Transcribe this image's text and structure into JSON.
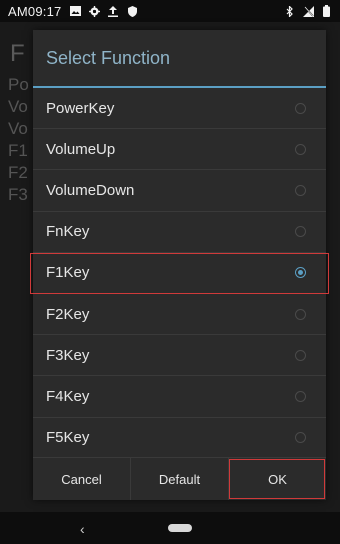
{
  "status_bar": {
    "time": "AM09:17",
    "left_icons": [
      "image-icon",
      "gear-icon",
      "upload-icon",
      "shield-icon"
    ],
    "right_icons": [
      "bluetooth-icon",
      "no-signal-icon",
      "battery-icon"
    ]
  },
  "background_app": {
    "title_initial": "F",
    "items": [
      "Po",
      "Vo",
      "Vo",
      "F1",
      "F2",
      "F3"
    ]
  },
  "dialog": {
    "title": "Select Function",
    "accent_color": "#5b9fc4",
    "options": [
      {
        "label": "PowerKey",
        "selected": false
      },
      {
        "label": "VolumeUp",
        "selected": false
      },
      {
        "label": "VolumeDown",
        "selected": false
      },
      {
        "label": "FnKey",
        "selected": false
      },
      {
        "label": "F1Key",
        "selected": true
      },
      {
        "label": "F2Key",
        "selected": false
      },
      {
        "label": "F3Key",
        "selected": false
      },
      {
        "label": "F4Key",
        "selected": false
      },
      {
        "label": "F5Key",
        "selected": false
      }
    ],
    "buttons": {
      "cancel": "Cancel",
      "default": "Default",
      "ok": "OK"
    },
    "highlight_color": "#d03a3a"
  },
  "nav_bar": {
    "back_glyph": "‹"
  }
}
